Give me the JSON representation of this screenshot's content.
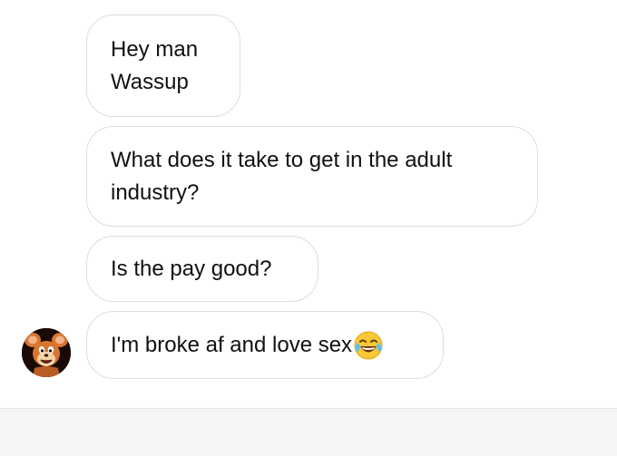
{
  "messages": [
    {
      "lines": [
        "Hey man",
        "Wassup"
      ]
    },
    {
      "lines": [
        "What does it take to get in the adult",
        "industry?"
      ]
    },
    {
      "lines": [
        "Is the pay good?"
      ]
    },
    {
      "lines": [
        "I'm broke af and love sex"
      ],
      "trailing_emoji": "face-with-tears-of-joy-icon"
    }
  ],
  "sender_avatar": {
    "icon": "cartoon-mouse-avatar-icon"
  },
  "colors": {
    "bubble_border": "#dedede",
    "background": "#ffffff",
    "footer_background": "#f6f6f6"
  }
}
